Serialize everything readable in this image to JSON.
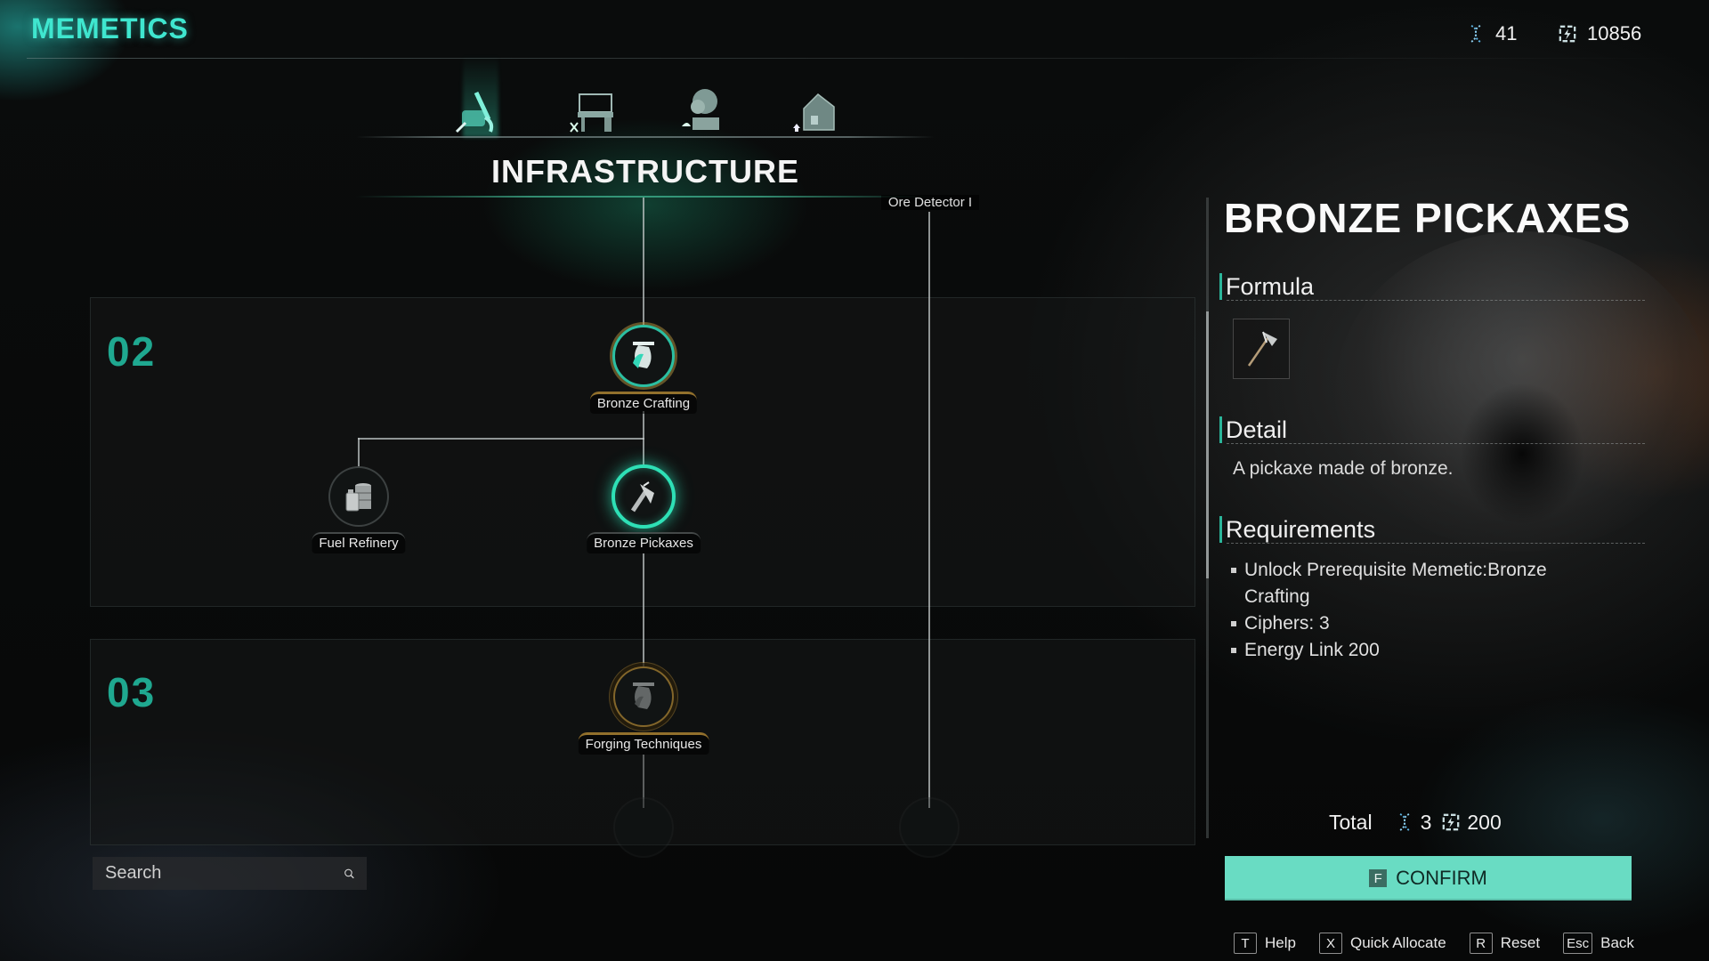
{
  "header": {
    "title": "MEMETICS",
    "currencies": [
      {
        "name": "Ciphers",
        "icon": "cipher-icon",
        "value": "41"
      },
      {
        "name": "Energy Link",
        "icon": "energy-link-icon",
        "value": "10856"
      }
    ]
  },
  "tabs": [
    {
      "name": "infrastructure",
      "icon": "pickaxe-tools-icon",
      "active": true
    },
    {
      "name": "crafting",
      "icon": "workbench-icon",
      "active": false
    },
    {
      "name": "farming",
      "icon": "planter-icon",
      "active": false
    },
    {
      "name": "building",
      "icon": "house-icon",
      "active": false
    }
  ],
  "category_title": "INFRASTRUCTURE",
  "tree": {
    "branch_label": "Ore Detector I",
    "tiers": [
      {
        "label": "02"
      },
      {
        "label": "03"
      }
    ],
    "nodes": [
      {
        "label": "Bronze Crafting",
        "state": "unlocked",
        "icon": "bronze-crafting-icon"
      },
      {
        "label": "Fuel Refinery",
        "state": "locked",
        "icon": "fuel-barrel-icon"
      },
      {
        "label": "Bronze Pickaxes",
        "state": "selected",
        "icon": "pickaxe-icon"
      },
      {
        "label": "Forging Techniques",
        "state": "available",
        "icon": "forging-icon"
      }
    ]
  },
  "search": {
    "placeholder": "Search",
    "value": ""
  },
  "detail_panel": {
    "title": "BRONZE PICKAXES",
    "formula_heading": "Formula",
    "formula_item": "bronze-pickaxe-icon",
    "detail_heading": "Detail",
    "detail_text": "A pickaxe made of bronze.",
    "requirements_heading": "Requirements",
    "requirements": [
      "Unlock Prerequisite Memetic:Bronze Crafting",
      "Ciphers:  3",
      "Energy Link 200"
    ],
    "total_label": "Total",
    "total_ciphers": "3",
    "total_energy": "200",
    "confirm_key": "F",
    "confirm_label": "CONFIRM"
  },
  "hints": [
    {
      "key": "T",
      "label": "Help"
    },
    {
      "key": "X",
      "label": "Quick Allocate"
    },
    {
      "key": "R",
      "label": "Reset"
    },
    {
      "key": "Esc",
      "label": "Back"
    }
  ],
  "colors": {
    "accent": "#3fe6cf",
    "confirm_bg": "#69dcc3",
    "tier_number": "#1fa890",
    "node_gold": "#aa8232"
  }
}
